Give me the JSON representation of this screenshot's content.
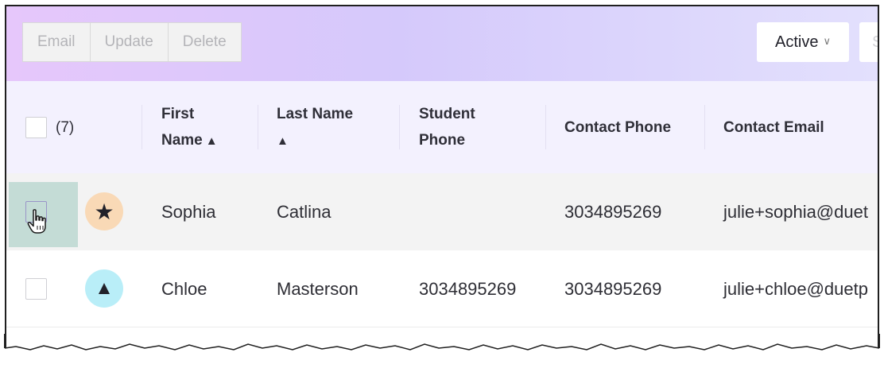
{
  "toolbar": {
    "actions": [
      "Email",
      "Update",
      "Delete"
    ],
    "status_filter": "Active",
    "cut_button_label": "S"
  },
  "table": {
    "selected_count": "(7)",
    "columns": {
      "first_name": [
        "First",
        "Name"
      ],
      "last_name": "Last Name",
      "student_phone": [
        "Student",
        "Phone"
      ],
      "contact_phone": "Contact Phone",
      "contact_email": "Contact Email"
    },
    "rows": [
      {
        "avatar_icon": "star-icon",
        "avatar_color": "#f9d9b6",
        "first_name": "Sophia",
        "last_name": "Catlina",
        "student_phone": "",
        "contact_phone": "3034895269",
        "contact_email": "julie+sophia@duet"
      },
      {
        "avatar_icon": "triangle-icon",
        "avatar_color": "#b9eef8",
        "first_name": "Chloe",
        "last_name": "Masterson",
        "student_phone": "3034895269",
        "contact_phone": "3034895269",
        "contact_email": "julie+chloe@duetp"
      }
    ]
  },
  "colors": {
    "toolbar_gradient_start": "#e6c7fb",
    "toolbar_gradient_end": "#e3e0fd",
    "header_bg": "#f3f1fe",
    "hover_highlight": "#c4dcd6"
  }
}
